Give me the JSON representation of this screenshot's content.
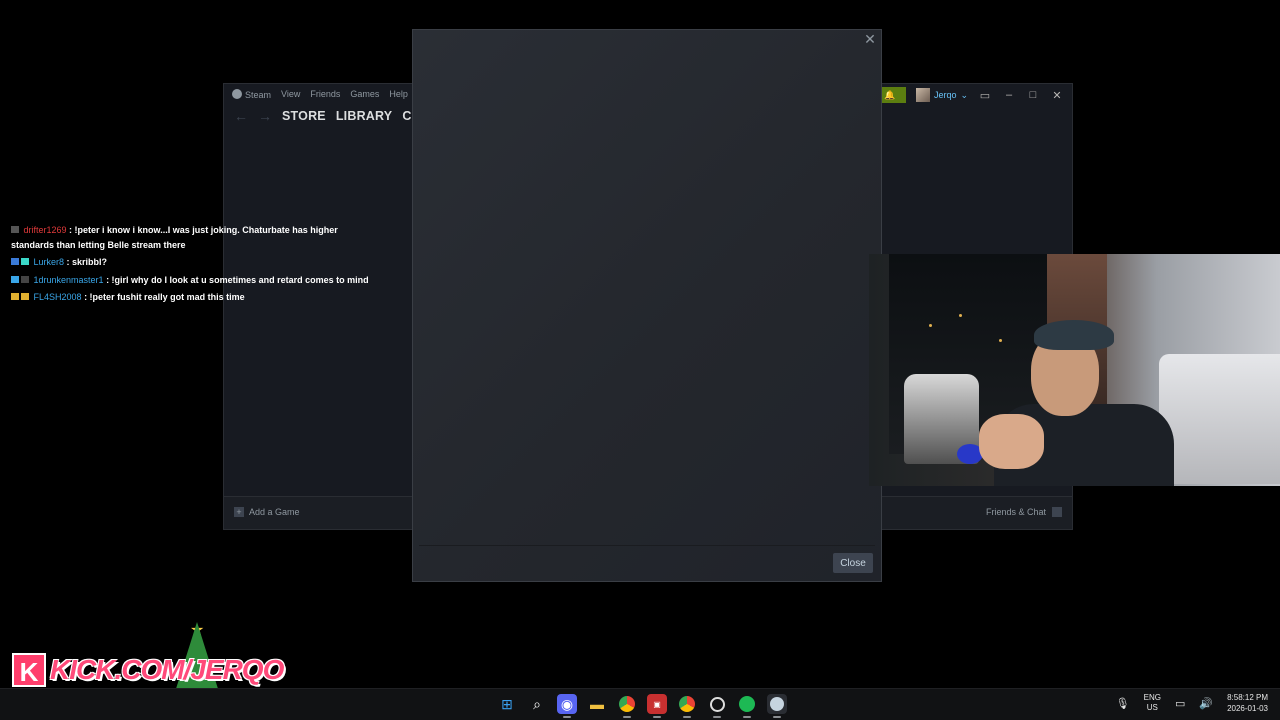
{
  "steam": {
    "menu": [
      "Steam",
      "View",
      "Friends",
      "Games",
      "Help"
    ],
    "nav_tabs": [
      "STORE",
      "LIBRARY",
      "COM"
    ],
    "username": "Jerqo",
    "add_game_label": "Add a Game",
    "friends_chat_label": "Friends & Chat"
  },
  "modal": {
    "close_button_label": "Close",
    "close_x": "✕"
  },
  "chat": {
    "messages": [
      {
        "user": "drifter1269",
        "user_color": "#e03a3a",
        "text": " : !peter i know i know...I was just joking. Chaturbate has higher standards than letting Belle stream there"
      },
      {
        "user": "Lurker8",
        "user_color": "#3aa6e8",
        "text": " : skribbl?"
      },
      {
        "user": "1drunkenmaster1",
        "user_color": "#3aa6e8",
        "text": " : !girl why do I look at u sometimes and retard comes to mind"
      },
      {
        "user": "FL4SH2008",
        "user_color": "#3aa6e8",
        "text": " : !peter fushit really got mad this time"
      }
    ]
  },
  "kick": {
    "k_letter": "K",
    "banner_text": "KICK.COM/JERQO"
  },
  "taskbar": {
    "icons": [
      "windows-start-icon",
      "search-icon",
      "discord-icon",
      "file-explorer-icon",
      "chrome-icon",
      "streaming-app-icon",
      "chrome-alt-icon",
      "obs-icon",
      "spotify-icon",
      "steam-icon"
    ],
    "lang_line1": "ENG",
    "lang_line2": "US",
    "time": "8:58:12 PM",
    "date": "2026-01-03"
  },
  "colors": {
    "steam_bg": "#171a21",
    "notification_green": "#5c7e10",
    "kick_pink": "#ff3e6c",
    "modal_bg": "#24272d"
  }
}
